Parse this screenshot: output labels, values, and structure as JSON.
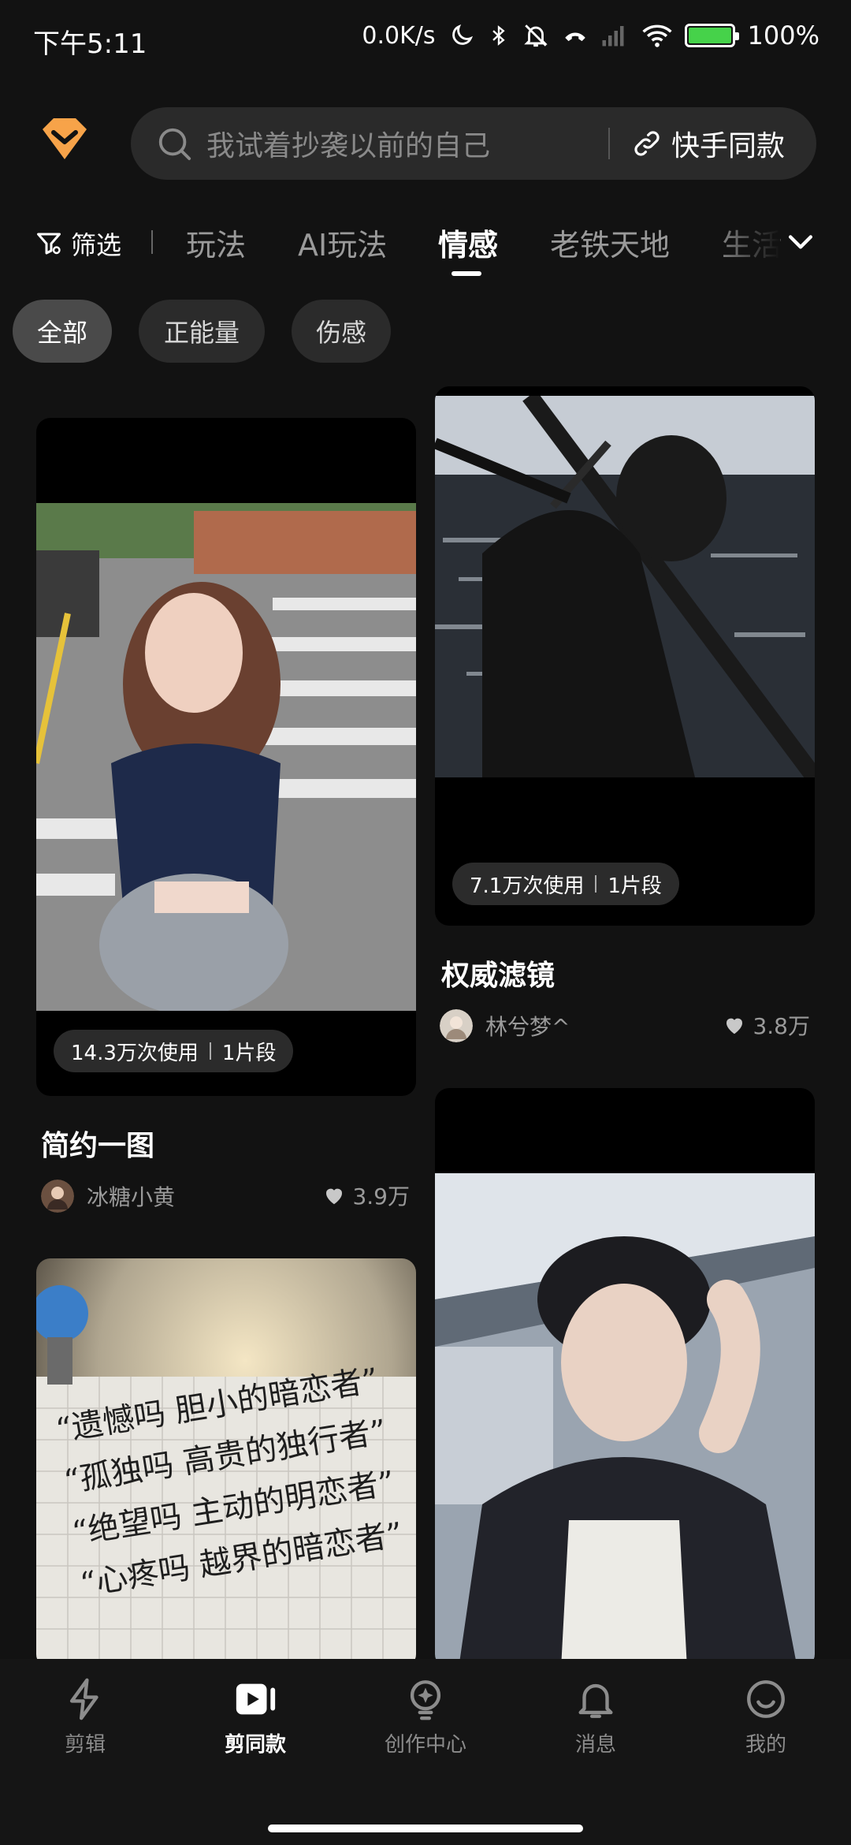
{
  "status_bar": {
    "time": "下午5:11",
    "speed": "0.0K/s",
    "battery": "100%",
    "battery_level": 1.0,
    "icons": [
      "moon-icon",
      "bluetooth-icon",
      "mute-icon",
      "call-icon",
      "signal-icon",
      "wifi-icon",
      "battery-icon"
    ]
  },
  "search": {
    "placeholder": "我试着抄袭以前的自己",
    "kuaishou_label": "快手同款"
  },
  "tabs": {
    "filter_label": "筛选",
    "items": [
      "玩法",
      "AI玩法",
      "情感",
      "老铁天地",
      "生活"
    ],
    "active": "情感"
  },
  "chips": {
    "items": [
      "全部",
      "正能量",
      "伤感"
    ],
    "active": "全部"
  },
  "cards": [
    {
      "usage": "14.3万次使用",
      "segments": "1片段",
      "title": "简约一图",
      "author": "冰糖小黄",
      "likes": "3.9万"
    },
    {
      "usage": "7.1万次使用",
      "segments": "1片段",
      "title": "权威滤镜",
      "author": "林兮梦^",
      "likes": "3.8万"
    },
    {
      "image_text": "“遗憾吗 胆小的暗恋者” “孤独吗 高贵的独行者” “绝望吗 主动的明恋者” “心疼吗 越界的暗恋者”"
    },
    {}
  ],
  "bottom_nav": {
    "items": [
      "剪辑",
      "剪同款",
      "创作中心",
      "消息",
      "我的"
    ],
    "active": "剪同款"
  },
  "colors": {
    "background": "#121212",
    "surface": "#2a2a2a",
    "logo_orange": "#f7a349",
    "battery_green": "#46d24a"
  }
}
